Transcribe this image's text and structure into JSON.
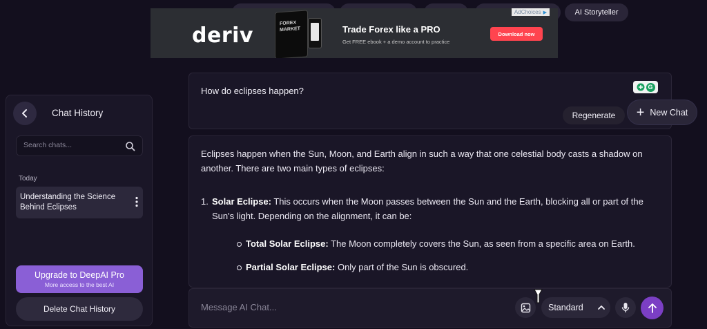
{
  "nav": {
    "storyteller_label": "AI Storyteller"
  },
  "ad": {
    "brand": "deriv",
    "tablet_text": "FOREX MARKET",
    "headline": "Trade Forex like a PRO",
    "subline": "Get FREE ebook + a demo account to practice",
    "cta": "Download now",
    "adchoices": "AdChoices",
    "cta_color": "#ff444f"
  },
  "sidebar": {
    "title": "Chat History",
    "search_placeholder": "Search chats...",
    "section_label": "Today",
    "items": [
      {
        "label": "Understanding the Science Behind Eclipses"
      }
    ],
    "upgrade_title": "Upgrade to DeepAI Pro",
    "upgrade_sub": "More access to the best AI",
    "delete_label": "Delete Chat History"
  },
  "chat": {
    "question": "How do eclipses happen?",
    "regenerate_label": "Regenerate",
    "new_chat_label": "New Chat",
    "answer": {
      "intro": "Eclipses happen when the Sun, Moon, and Earth align in such a way that one celestial body casts a shadow on another. There are two main types of eclipses:",
      "item1_num": "1.",
      "item1_title": "Solar Eclipse:",
      "item1_text": " This occurs when the Moon passes between the Sun and the Earth, blocking all or part of the Sun's light. Depending on the alignment, it can be:",
      "sub1_title": "Total Solar Eclipse:",
      "sub1_text": " The Moon completely covers the Sun, as seen from a specific area on Earth.",
      "sub2_title": "Partial Solar Eclipse:",
      "sub2_text": " Only part of the Sun is obscured."
    }
  },
  "composer": {
    "placeholder": "Message AI Chat...",
    "model_label": "Standard",
    "accent": "#7b3fc4"
  },
  "icons": [
    "chevron-left-icon",
    "search-icon",
    "kebab-icon",
    "plus-icon",
    "image-icon",
    "chevron-up-icon",
    "mic-icon",
    "arrow-up-icon",
    "grammarly-icon"
  ]
}
